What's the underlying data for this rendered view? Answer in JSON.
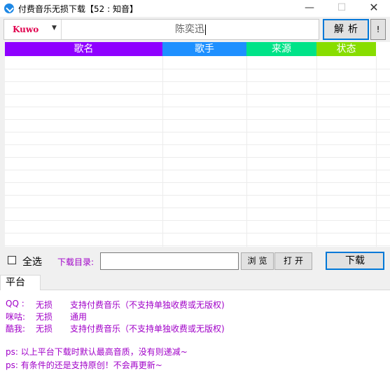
{
  "window": {
    "title": "付费音乐无损下载【52 : 知音】",
    "minimize_glyph": "—",
    "maximize_glyph": "☐",
    "close_glyph": "✕"
  },
  "toolbar": {
    "source_value": "Kuwo",
    "source_arrow": "▼",
    "search_value": "陈奕迅",
    "parse_label": "解析",
    "info_label": "!"
  },
  "table": {
    "columns": [
      "歌名",
      "歌手",
      "来源",
      "状态"
    ],
    "rows": []
  },
  "controls": {
    "select_all_label": "全选",
    "select_all_checked": false,
    "download_dir_label": "下载目录:",
    "download_dir_value": "",
    "browse_label": "浏览",
    "open_label": "打开",
    "download_label": "下载"
  },
  "tabs": [
    "平台"
  ],
  "info": [
    [
      "QQ :",
      "无损",
      "支持付费音乐（不支持单独收费或无版权)"
    ],
    [
      "咪咕:",
      "无损",
      "通用"
    ],
    [
      "酷我:",
      "无损",
      "支持付费音乐（不支持单独收费或无版权)"
    ]
  ],
  "notes": [
    "ps: 以上平台下载时默认最高音质，没有则递减~",
    "ps: 有条件的还是支持原创！不会再更新~"
  ],
  "colors": {
    "col_song": "#8f00ff",
    "col_singer": "#1e90ff",
    "col_source": "#00e388",
    "col_status": "#88dd00",
    "accent": "#0078d7",
    "info_text": "#a000c8",
    "source_text": "#e0004d"
  }
}
